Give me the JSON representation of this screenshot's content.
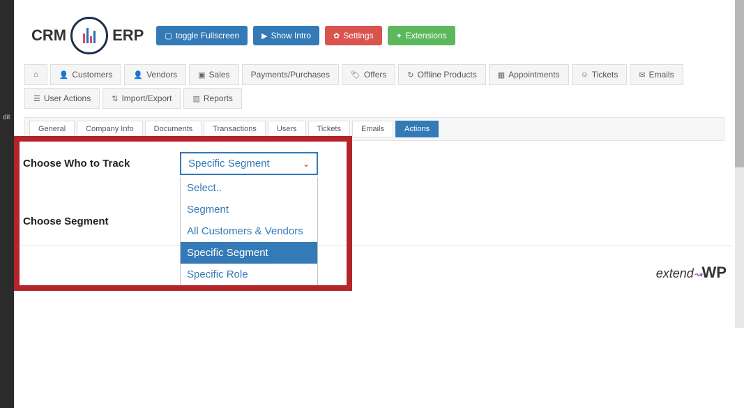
{
  "sidebar": {
    "label": "dit"
  },
  "logo": {
    "text_left": "CRM",
    "text_right": "ERP"
  },
  "header_buttons": {
    "fullscreen": "toggle Fullscreen",
    "show_intro": "Show Intro",
    "settings": "Settings",
    "extensions": "Extensions"
  },
  "main_tabs": [
    {
      "label": ""
    },
    {
      "label": "Customers"
    },
    {
      "label": "Vendors"
    },
    {
      "label": "Sales"
    },
    {
      "label": "Payments/Purchases"
    },
    {
      "label": "Offers"
    },
    {
      "label": "Offline Products"
    },
    {
      "label": "Appointments"
    },
    {
      "label": "Tickets"
    },
    {
      "label": "Emails"
    },
    {
      "label": "User Actions"
    },
    {
      "label": "Import/Export"
    },
    {
      "label": "Reports"
    }
  ],
  "sub_tabs": {
    "general": "General",
    "company_info": "Company Info",
    "documents": "Documents",
    "transactions": "Transactions",
    "users": "Users",
    "tickets": "Tickets",
    "emails": "Emails",
    "actions": "Actions"
  },
  "form": {
    "choose_who_label": "Choose Who to Track",
    "choose_segment_label": "Choose Segment",
    "select_value": "Specific Segment",
    "options": {
      "select": "Select..",
      "segment": "Segment",
      "all": "All Customers & Vendors",
      "specific_segment": "Specific Segment",
      "specific_role": "Specific Role"
    }
  },
  "footer_brand": {
    "text": "extend",
    "suffix": "WP"
  }
}
